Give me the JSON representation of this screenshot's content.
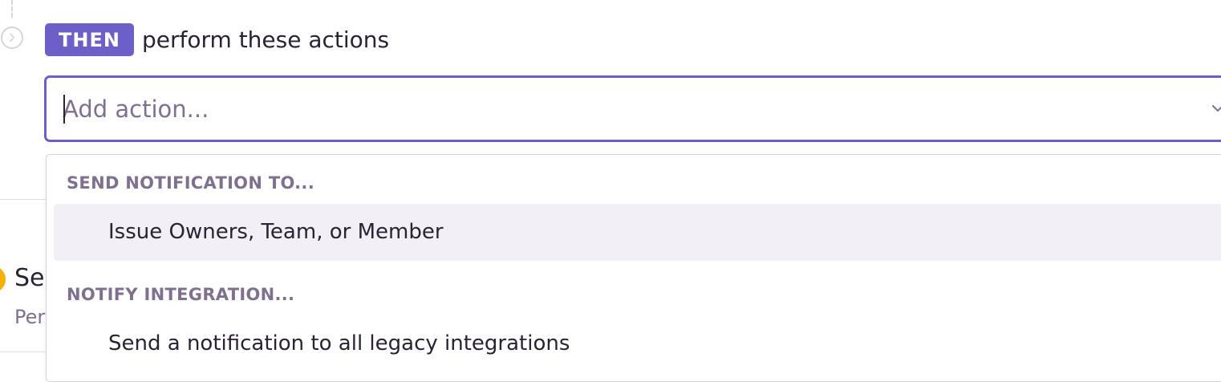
{
  "rule_step": {
    "badge": "THEN",
    "heading": "perform these actions"
  },
  "action_select": {
    "placeholder": "Add action...",
    "value": ""
  },
  "dropdown": {
    "groups": [
      {
        "header": "SEND NOTIFICATION TO...",
        "options": [
          {
            "label": "Issue Owners, Team, or Member",
            "highlighted": true
          }
        ]
      },
      {
        "header": "NOTIFY INTEGRATION...",
        "options": [
          {
            "label": "Send a notification to all legacy integrations",
            "highlighted": false
          }
        ]
      }
    ]
  },
  "background_section": {
    "title_fragment": "Se",
    "subtitle_fragment": "Per"
  },
  "colors": {
    "accent": "#6c5fc7",
    "text": "#2b2233",
    "muted": "#80708f",
    "warning": "#f5b000",
    "hover_bg": "#f2f0f6"
  },
  "icons": {
    "step_marker": "chevron-right-circle-icon",
    "select_indicator": "chevron-down-icon",
    "warning": "warning-dot-icon"
  }
}
